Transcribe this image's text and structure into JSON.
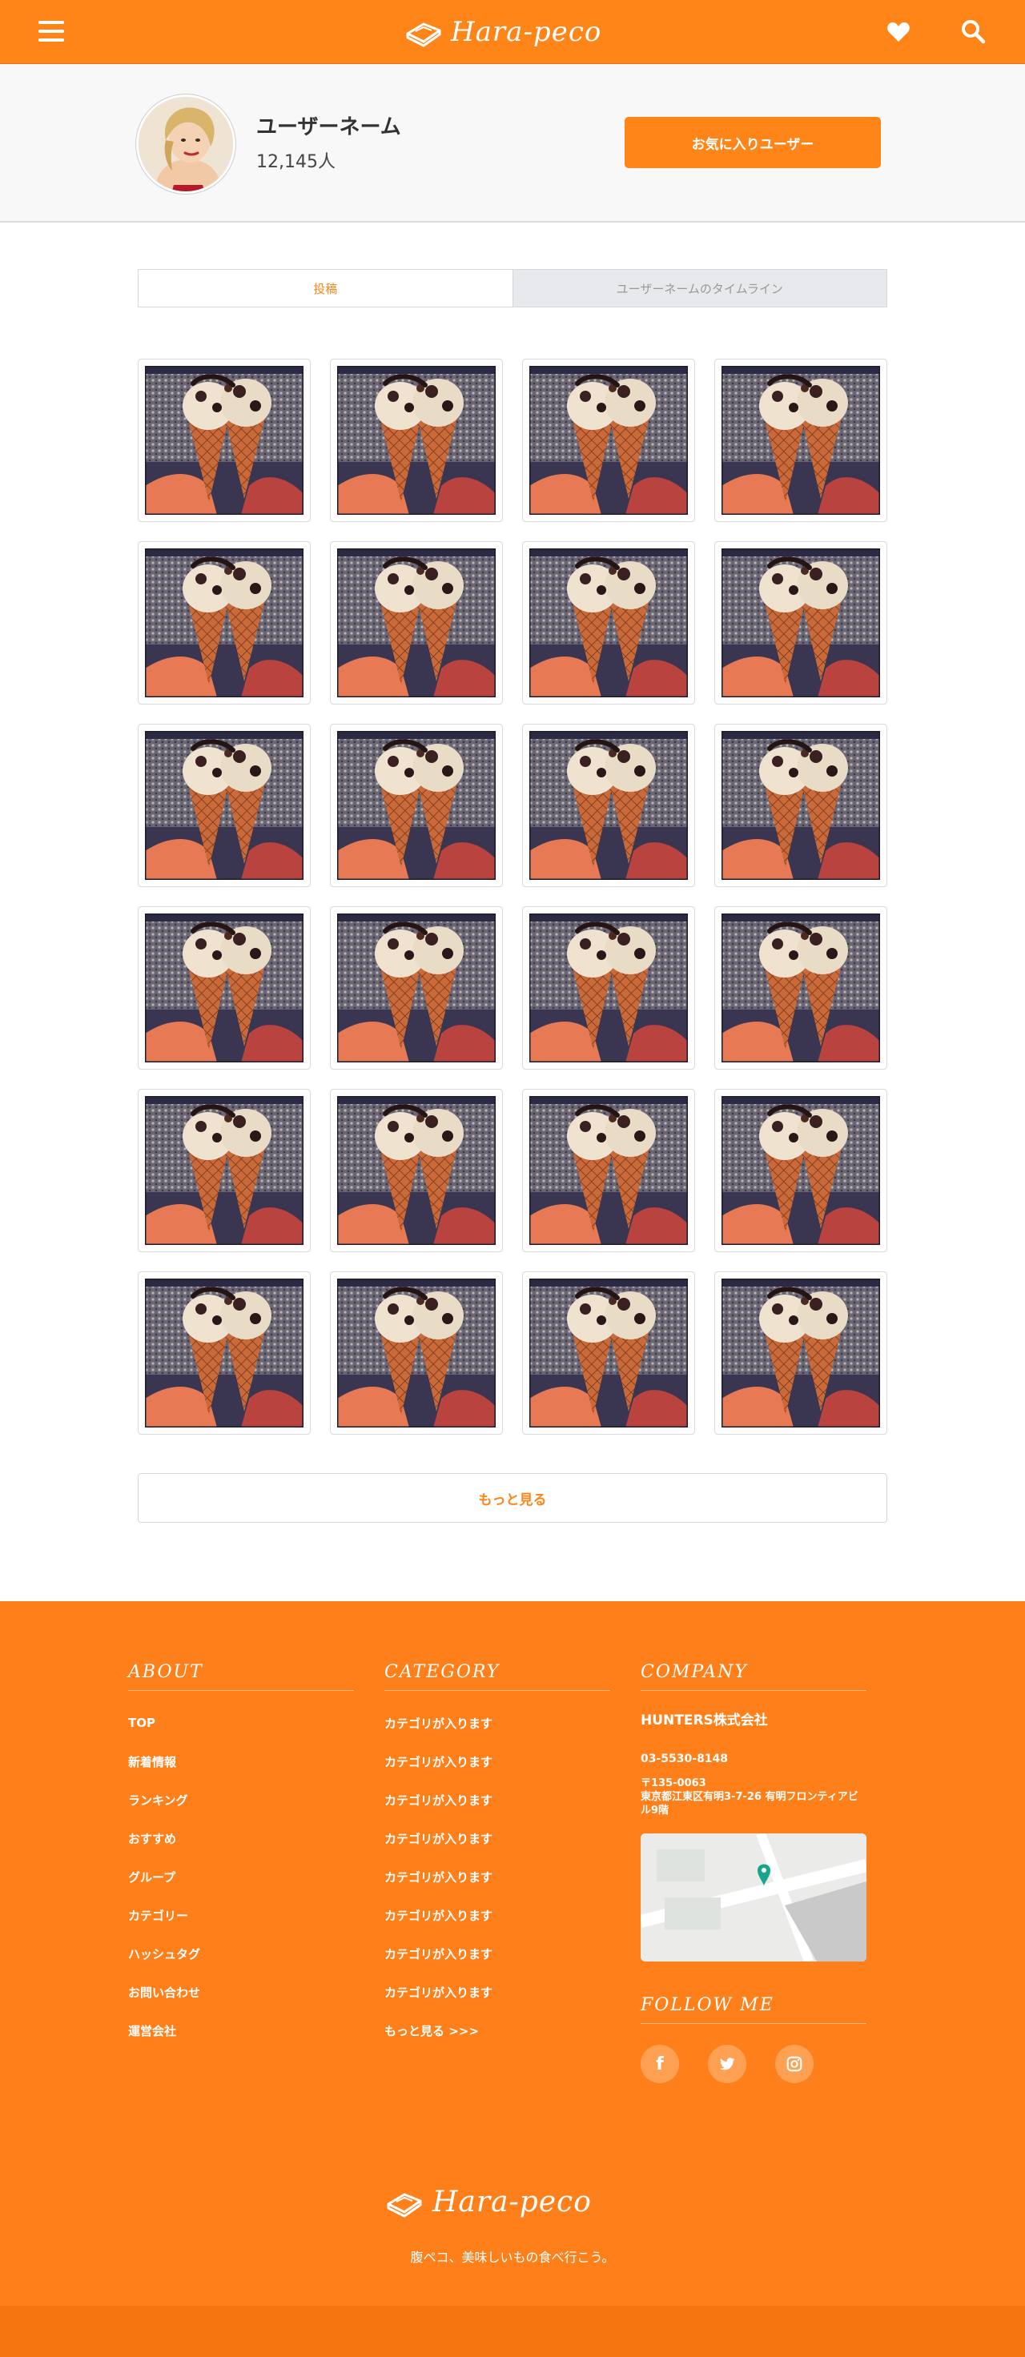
{
  "header": {
    "logo_text": "Hara-peco",
    "menu_icon": "hamburger-menu-icon",
    "favorite_icon": "heart-icon",
    "search_icon": "search-icon"
  },
  "profile": {
    "username": "ユーザーネーム",
    "followers": "12,145人",
    "favorite_button": "お気に入りユーザー"
  },
  "tabs": [
    {
      "label": "投稿",
      "active": true
    },
    {
      "label": "ユーザーネームのタイムライン",
      "active": false
    }
  ],
  "grid": {
    "rows": 6,
    "columns": 4,
    "image_subject": "ice-cream-cones-photo"
  },
  "more_button": "もっと見る",
  "footer": {
    "about": {
      "title": "ABOUT",
      "links": [
        "TOP",
        "新着情報",
        "ランキング",
        "おすすめ",
        "グループ",
        "カテゴリー",
        "ハッシュタグ",
        "お問い合わせ",
        "運営会社"
      ]
    },
    "category": {
      "title": "CATEGORY",
      "links": [
        "カテゴリが入ります",
        "カテゴリが入ります",
        "カテゴリが入ります",
        "カテゴリが入ります",
        "カテゴリが入ります",
        "カテゴリが入ります",
        "カテゴリが入ります",
        "カテゴリが入ります",
        "もっと見る >>>"
      ]
    },
    "company": {
      "title": "COMPANY",
      "name": "HUNTERS株式会社",
      "tel": "03-5530-8148",
      "postal": "〒135-0063",
      "address": "東京都江東区有明3-7-26 有明フロンティアビル9階"
    },
    "follow": {
      "title": "FOLLOW ME",
      "socials": [
        "f",
        "t",
        "i"
      ]
    },
    "logo_text": "Hara-peco",
    "tagline": "腹ペコ、美味しいもの食べ行こう。"
  },
  "colors": {
    "accent": "#ff8519",
    "footer": "#ff801a",
    "footer_bottom": "#f57510"
  }
}
